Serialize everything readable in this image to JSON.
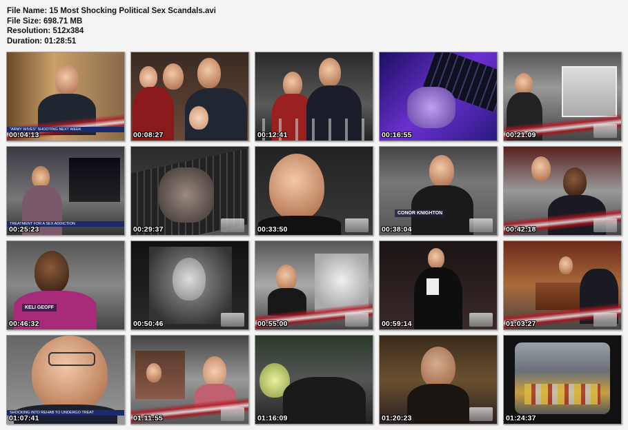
{
  "header": {
    "file_name": "File Name: 15 Most Shocking Political Sex Scandals.avi",
    "file_size": "File Size: 698.71 MB",
    "resolution": "Resolution: 512x384",
    "duration": "Duration: 01:28:51"
  },
  "thumbnails": [
    {
      "time": "00:04:13",
      "caption": "",
      "ticker": "\"ARMY WIVES\" SHOOTING NEXT WEEK"
    },
    {
      "time": "00:08:27",
      "caption": "",
      "ticker": ""
    },
    {
      "time": "00:12:41",
      "caption": "",
      "ticker": ""
    },
    {
      "time": "00:16:55",
      "caption": "",
      "ticker": ""
    },
    {
      "time": "00:21:09",
      "caption": "",
      "ticker": ""
    },
    {
      "time": "00:25:23",
      "caption": "",
      "ticker": "TREATMENT FOR A SEX ADDICTION"
    },
    {
      "time": "00:29:37",
      "caption": "",
      "ticker": ""
    },
    {
      "time": "00:33:50",
      "caption": "",
      "ticker": ""
    },
    {
      "time": "00:38:04",
      "caption": "CONOR KNIGHTON",
      "ticker": ""
    },
    {
      "time": "00:42:18",
      "caption": "",
      "ticker": ""
    },
    {
      "time": "00:46:32",
      "caption": "KELI GEOFF",
      "ticker": ""
    },
    {
      "time": "00:50:46",
      "caption": "",
      "ticker": ""
    },
    {
      "time": "00:55:00",
      "caption": "",
      "ticker": ""
    },
    {
      "time": "00:59:14",
      "caption": "",
      "ticker": ""
    },
    {
      "time": "01:03:27",
      "caption": "",
      "ticker": ""
    },
    {
      "time": "01:07:41",
      "caption": "",
      "ticker": "SHOCKING INTO REHAB TO UNDERGO TREAT"
    },
    {
      "time": "01:11:55",
      "caption": "",
      "ticker": ""
    },
    {
      "time": "01:16:09",
      "caption": "",
      "ticker": ""
    },
    {
      "time": "01:20:23",
      "caption": "",
      "ticker": ""
    },
    {
      "time": "01:24:37",
      "caption": "",
      "ticker": ""
    }
  ]
}
